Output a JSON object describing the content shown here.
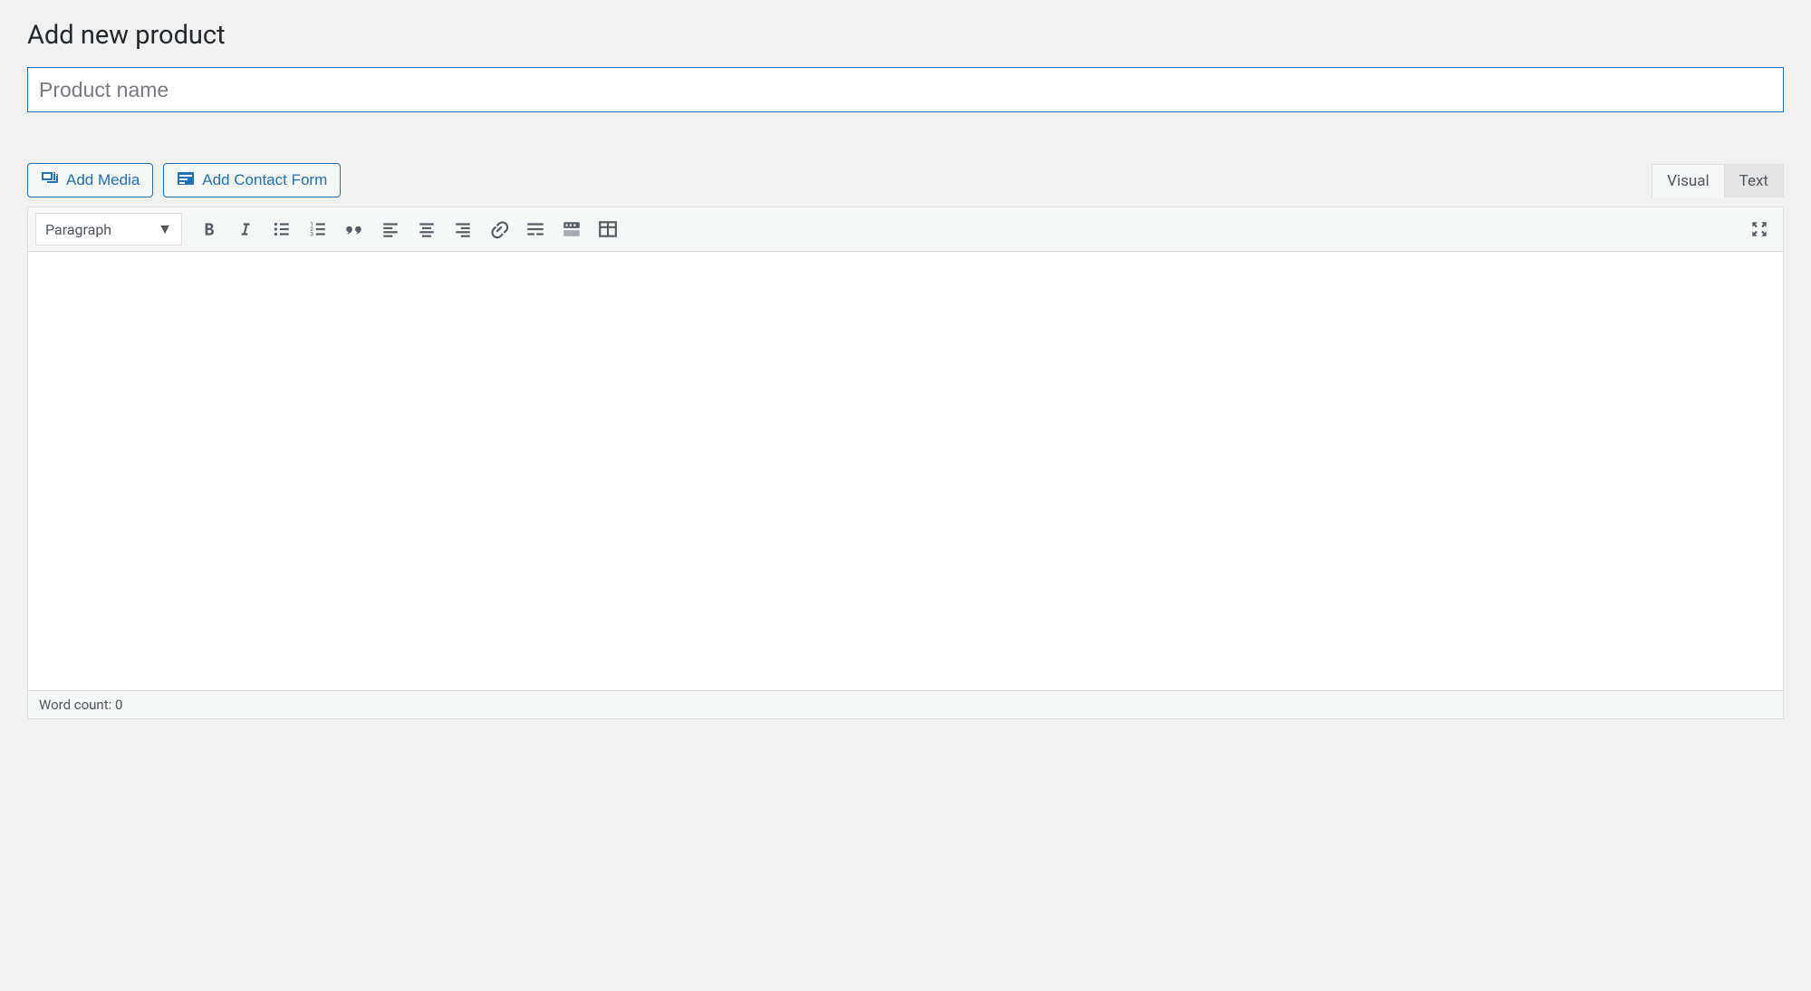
{
  "page": {
    "title": "Add new product"
  },
  "title_field": {
    "placeholder": "Product name",
    "value": ""
  },
  "media_buttons": {
    "add_media": "Add Media",
    "add_contact_form": "Add Contact Form"
  },
  "editor": {
    "tabs": {
      "visual": "Visual",
      "text": "Text"
    },
    "format_select": "Paragraph",
    "status_prefix": "Word count: ",
    "word_count": "0",
    "content": ""
  }
}
